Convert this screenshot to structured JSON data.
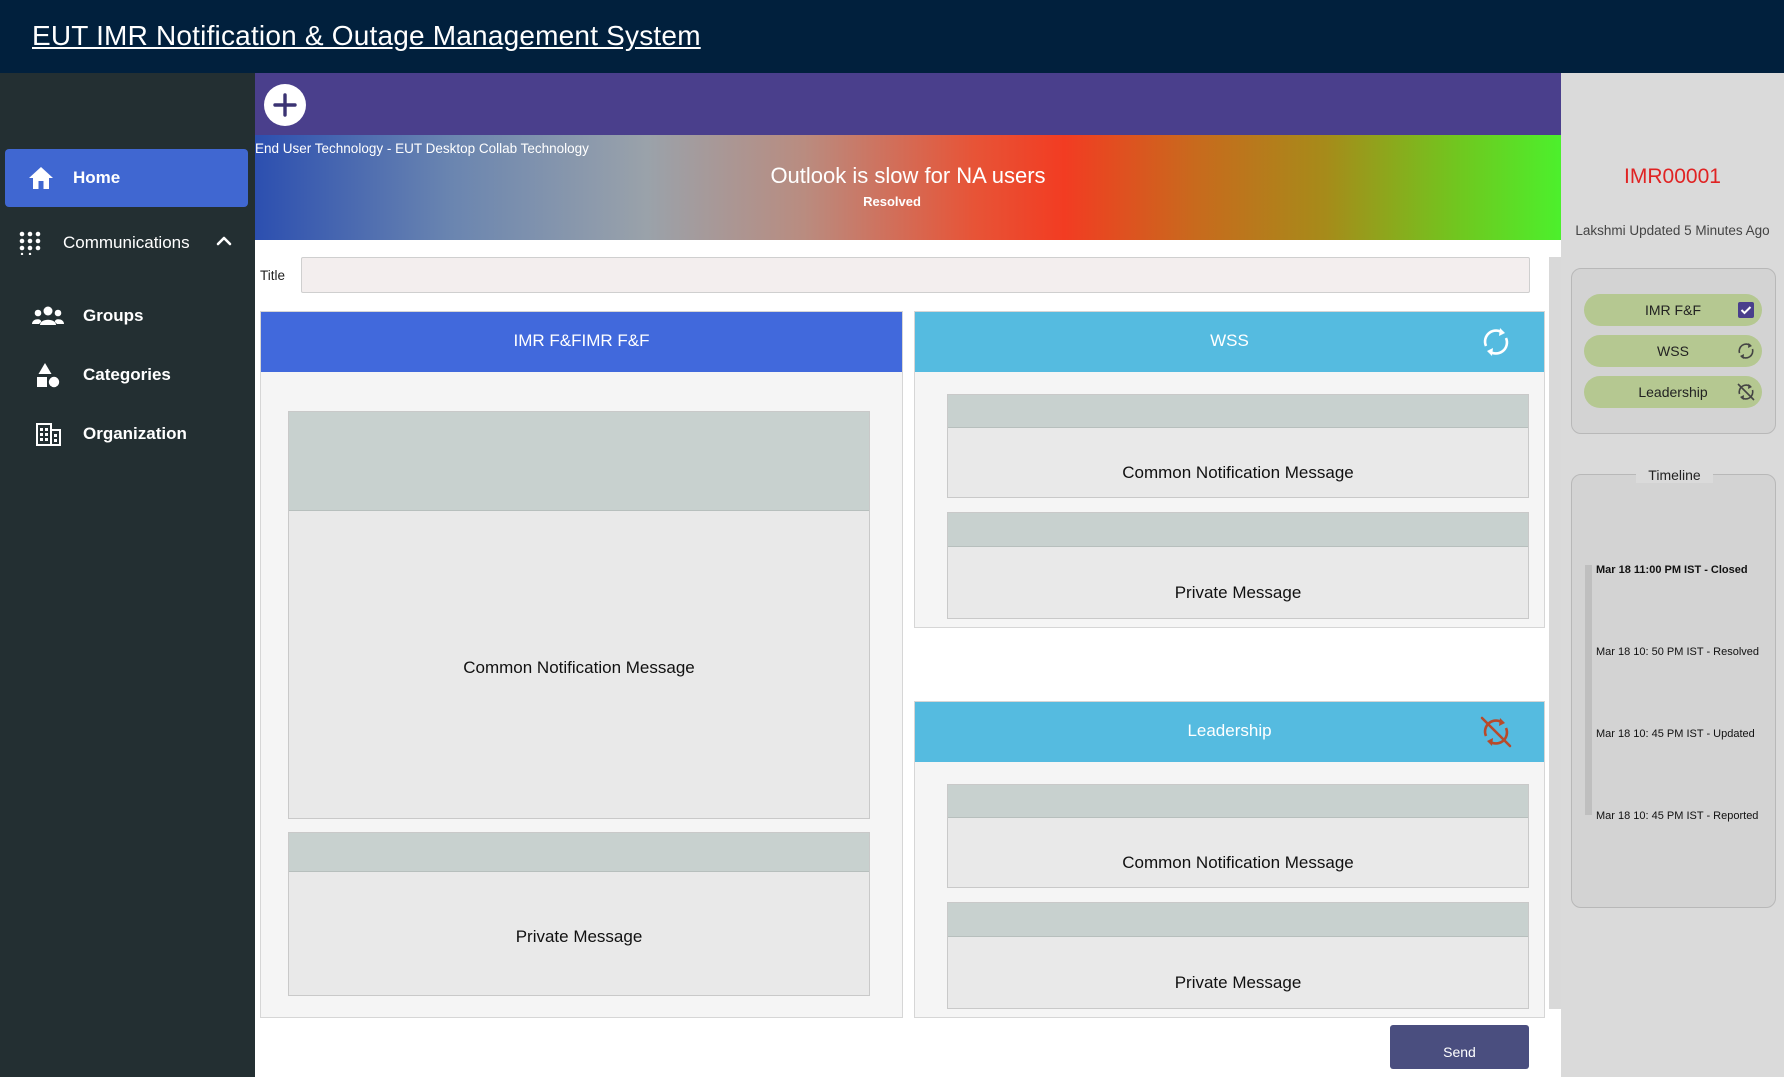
{
  "app": {
    "title": "EUT IMR Notification & Outage Management System"
  },
  "sidebar": {
    "home": "Home",
    "communications": "Communications",
    "items": [
      {
        "label": "Groups",
        "icon": "groups-icon"
      },
      {
        "label": "Categories",
        "icon": "categories-icon"
      },
      {
        "label": "Organization",
        "icon": "organization-icon"
      }
    ]
  },
  "banner": {
    "org": "End User Technology - EUT Desktop Collab Technology",
    "headline": "Outlook is slow for NA users",
    "status": "Resolved"
  },
  "form": {
    "title_label": "Title",
    "title_value": ""
  },
  "panels": {
    "imr": {
      "title": "IMR F&FIMR F&F",
      "common": "Common Notification Message",
      "private": "Private Message",
      "color": "#4169dc"
    },
    "wss": {
      "title": "WSS",
      "common": "Common Notification Message",
      "private": "Private Message",
      "icon": "refresh-icon",
      "color": "#55bbe0"
    },
    "leadership": {
      "title": "Leadership",
      "common": "Common Notification Message",
      "private": "Private Message",
      "icon": "sync-disabled-icon",
      "color": "#55bbe0"
    }
  },
  "actions": {
    "send": "Send"
  },
  "incident": {
    "id": "IMR00001",
    "updated": "Lakshmi Updated 5 Minutes Ago",
    "groups": [
      {
        "label": "IMR F&F",
        "icon": "checkbox-checked-icon"
      },
      {
        "label": "WSS",
        "icon": "refresh-icon"
      },
      {
        "label": "Leadership",
        "icon": "sync-disabled-icon"
      }
    ],
    "timeline_title": "Timeline",
    "timeline": [
      "Mar 18 11:00 PM IST - Closed",
      "Mar 18 10: 50 PM IST - Resolved",
      "Mar 18 10: 45 PM IST - Updated",
      "Mar 18 10: 45 PM IST - Reported"
    ]
  },
  "colors": {
    "topbar": "#01203d",
    "sidebar": "#232f32",
    "active_nav": "#4067d1",
    "toolbar": "#4a3f8c",
    "incident_id": "#e02323",
    "group_pill": "#b5c891",
    "send_button": "#4a4e7f"
  }
}
